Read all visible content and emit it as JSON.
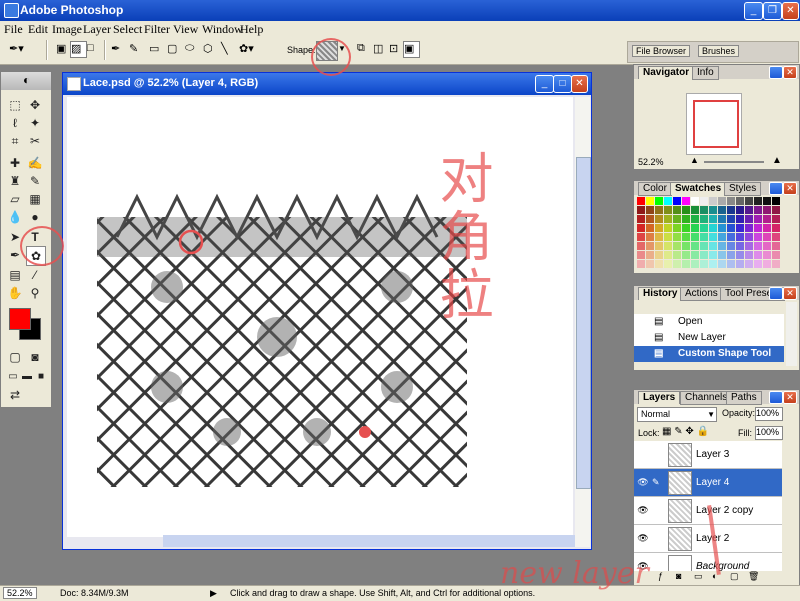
{
  "app": {
    "title": "Adobe Photoshop"
  },
  "menu": [
    "File",
    "Edit",
    "Image",
    "Layer",
    "Select",
    "Filter",
    "View",
    "Window",
    "Help"
  ],
  "options": {
    "shape_label": "Shape:"
  },
  "palette_well": {
    "file_browser": "File Browser",
    "brushes": "Brushes"
  },
  "document": {
    "title": "Lace.psd @ 52.2% (Layer 4, RGB)"
  },
  "navigator": {
    "tabs": [
      "Navigator",
      "Info"
    ],
    "zoom": "52.2%"
  },
  "swatches": {
    "tabs": [
      "Color",
      "Swatches",
      "Styles"
    ]
  },
  "history": {
    "tabs": [
      "History",
      "Actions",
      "Tool Presets"
    ],
    "items": [
      "Open",
      "New Layer",
      "Custom Shape Tool"
    ]
  },
  "layers": {
    "tabs": [
      "Layers",
      "Channels",
      "Paths"
    ],
    "blend_mode": "Normal",
    "opacity_label": "Opacity:",
    "opacity": "100%",
    "lock_label": "Lock:",
    "fill_label": "Fill:",
    "fill": "100%",
    "items": [
      "Layer 3",
      "Layer 4",
      "Layer 2 copy",
      "Layer 2",
      "Background"
    ]
  },
  "status": {
    "zoom": "52.2%",
    "doc": "Doc: 8.34M/9.3M",
    "hint": "Click and drag to draw a shape. Use Shift, Alt, and Ctrl for additional options."
  },
  "annotations": {
    "diagonal_drag": "对角拉",
    "new_layer": "new layer"
  },
  "colors": {
    "foreground": "#ff0000",
    "background": "#000000",
    "accent": "#e65050",
    "selection": "#3169c6"
  }
}
